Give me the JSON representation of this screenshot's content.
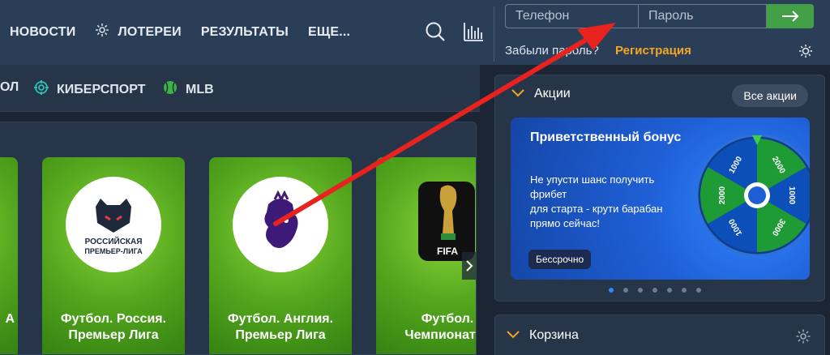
{
  "header": {
    "nav": [
      "НОВОСТИ",
      "ЛОТЕРЕИ",
      "РЕЗУЛЬТАТЫ",
      "ЕЩЕ..."
    ],
    "login": {
      "phone_placeholder": "Телефон",
      "password_placeholder": "Пароль",
      "forgot": "Забыли пароль?",
      "register": "Регистрация"
    }
  },
  "sports_bar": [
    "ОЛ",
    "КИБЕРСПОРТ",
    "MLB"
  ],
  "cards": [
    {
      "line1": "",
      "line2": "А"
    },
    {
      "line1": "Футбол. Россия.",
      "line2": "Премьер Лига",
      "logo_text": [
        "РОССИЙСКАЯ",
        "ПРЕМЬЕР-ЛИГА"
      ]
    },
    {
      "line1": "Футбол. Англия.",
      "line2": "Премьер Лига"
    },
    {
      "line1": "Футбол.",
      "line2": "Чемпионат М",
      "logo_text": "FIFA"
    }
  ],
  "promo": {
    "title": "Акции",
    "all_button": "Все акции",
    "banner": {
      "title": "Приветственный бонус",
      "text": [
        "Не упусти шанс получить фрибет",
        "для старта - крути барабан",
        "прямо сейчас!"
      ],
      "badge": "Бессрочно",
      "wheel_labels": [
        "2000",
        "1000",
        "3000",
        "1000",
        "2000",
        "1000"
      ]
    },
    "dots": 7,
    "active_dot": 0
  },
  "cart": {
    "title": "Корзина"
  },
  "colors": {
    "header_bg": "#2a3f57",
    "panel_bg": "#263648",
    "accent_green": "#43a047",
    "register": "#f5a623",
    "arrow": "#e8221f"
  }
}
